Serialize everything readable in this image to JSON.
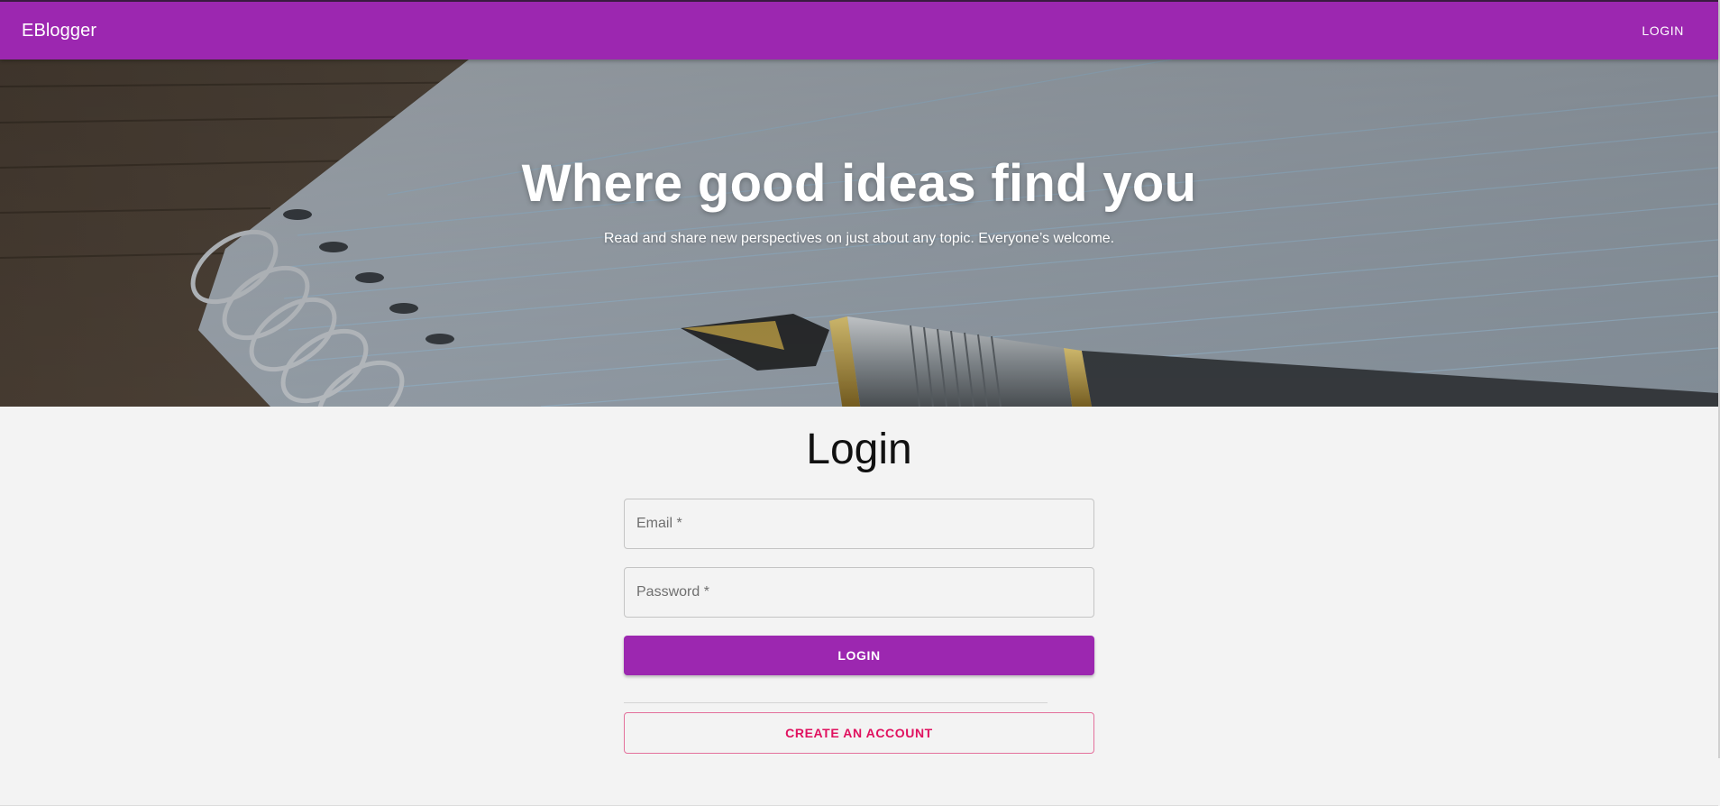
{
  "colors": {
    "primary": "#9c27b0",
    "secondary": "#e0115f",
    "background": "#f3f3f3"
  },
  "appbar": {
    "brand": "EBlogger",
    "login_label": "LOGIN"
  },
  "hero": {
    "title": "Where good ideas find you",
    "subtitle": "Read and share new perspectives on just about any topic. Everyone’s welcome.",
    "image_description_icon": "notebook-pen-photo"
  },
  "login_form": {
    "title": "Login",
    "email": {
      "placeholder": "Email *",
      "value": ""
    },
    "password": {
      "placeholder": "Password *",
      "value": ""
    },
    "submit_label": "LOGIN",
    "create_account_label": "CREATE AN ACCOUNT"
  }
}
